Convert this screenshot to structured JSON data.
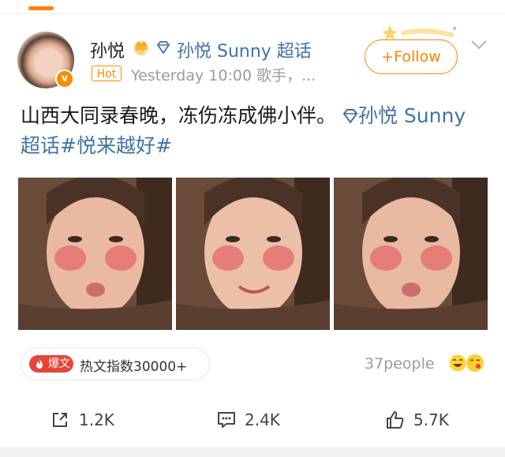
{
  "post": {
    "username": "孙悦",
    "supertopic_tag": "孙悦 Sunny 超话",
    "hot_badge": "Hot",
    "meta": "Yesterday 10:00  歌手，...",
    "follow_label": "+Follow",
    "text_main": "山西大同录春晚，冻伤冻成佛小伴。",
    "text_link": "孙悦 Sunny 超话",
    "text_hashtag": "#悦来越好#"
  },
  "hot_index": {
    "badge": "爆文",
    "text": "热文指数30000+"
  },
  "reactions": {
    "people": "37people"
  },
  "actions": {
    "share": "1.2K",
    "comment": "2.4K",
    "like": "5.7K"
  },
  "colors": {
    "accent": "#ff8200",
    "link": "#3f72a8",
    "badge_red": "#e2473a"
  },
  "icons": [
    "crown-icon",
    "diamond-icon",
    "chevron-down-icon",
    "fire-icon",
    "share-icon",
    "comment-icon",
    "like-icon"
  ]
}
